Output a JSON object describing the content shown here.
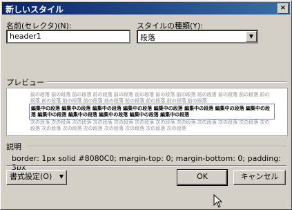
{
  "window": {
    "title": "新しいスタイル",
    "close": "×"
  },
  "selector": {
    "label": "名前(セレクタ)(N):",
    "value": "header1"
  },
  "style_type": {
    "label": "スタイルの種類(Y):",
    "value": "段落",
    "arrow": "▼"
  },
  "preview": {
    "label": "プレビュー",
    "before": "前の段落 前の段落 前の段落 前の段落 前の段落 前の段落 前の段落 前の段落 前の段落 前の段落 前の段落 前の段落 前の段落 前の段落 前の段落 前の段落 前の段落 前の段落 前の段落 前の段落",
    "current": "編集中の段落 編集中の段落 編集中の段落 編集中の段落 編集中の段落 編集中の段落 編集中の段落 編集中の段落 編集中の段落 編集中の段落 編集中の段落 編集中の段落 編集中の段落",
    "after": "次の段落 次の段落 次の段落 次の段落 次の段落 次の段落 次の段落 次の段落 次の段落 次の段落 次の段落 次の段落 次の段落 次の段落 次の段落 次の段落 次の段落 次の段落 次の段落"
  },
  "description": {
    "label": "説明",
    "text": "border: 1px solid #8080C0; margin-top: 0; margin-bottom: 0; padding: 3px"
  },
  "buttons": {
    "format": "書式設定(O)",
    "format_arrow": "▼",
    "ok": "OK",
    "cancel": "キャンセル"
  }
}
